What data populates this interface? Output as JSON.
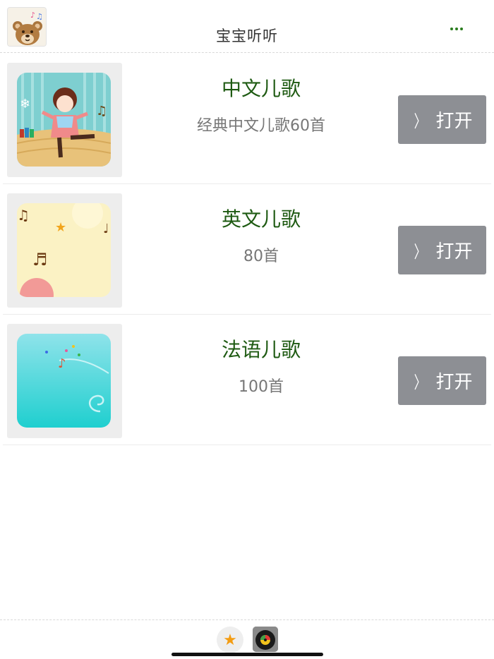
{
  "header": {
    "title": "宝宝听听",
    "logo_icon": "bear-music-icon",
    "more_icon": "more-dots-icon",
    "accent": "#2a7d1e"
  },
  "songs": [
    {
      "title": "中文儿歌",
      "subtitle": "经典中文儿歌60首",
      "button": "打开",
      "thumb_icon": "dancing-girl-icon"
    },
    {
      "title": "英文儿歌",
      "subtitle": "80首",
      "button": "打开",
      "thumb_icon": "music-notes-icon"
    },
    {
      "title": "法语儿歌",
      "subtitle": "100首",
      "button": "打开",
      "thumb_icon": "music-swirl-icon"
    }
  ],
  "footer": {
    "fav_icon": "star-icon",
    "player_icon": "vinyl-record-icon"
  },
  "colors": {
    "title_green": "#1e5a12",
    "button_gray": "#8d8f94",
    "star": "#f39c12"
  }
}
